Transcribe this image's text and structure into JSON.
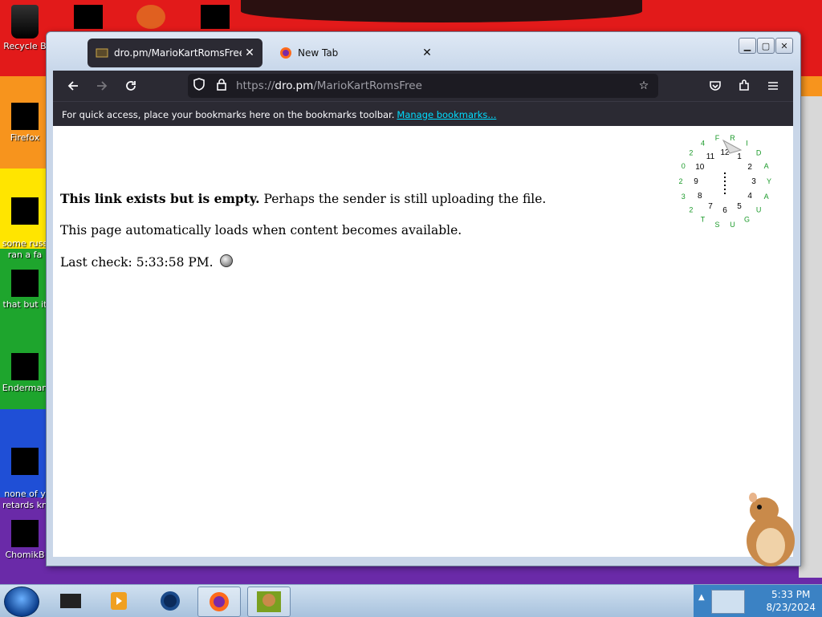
{
  "desktop": {
    "icons": [
      {
        "label": "Recycle Bin",
        "display": "Recycle B"
      },
      {
        "label": "Firefox",
        "display": "Firefox"
      },
      {
        "label": "some russ ran a fa",
        "display": "some russ\nran a fa"
      },
      {
        "label": "that but it",
        "display": "that but it"
      },
      {
        "label": "Enderman",
        "display": "Enderman"
      },
      {
        "label": "none of y retards kn",
        "display": "none of y\nretards kn"
      },
      {
        "label": "ChomikB",
        "display": "ChomikB"
      }
    ]
  },
  "browser": {
    "tabs": [
      {
        "title": "dro.pm/MarioKartRomsFree",
        "active": true
      },
      {
        "title": "New Tab",
        "active": false
      }
    ],
    "url": {
      "host": "dro.pm",
      "prefix": "https://",
      "path": "/MarioKartRomsFree"
    },
    "bookmarks_bar": {
      "text": "For quick access, place your bookmarks here on the bookmarks toolbar.",
      "link": "Manage bookmarks..."
    }
  },
  "page": {
    "line1_bold": "This link exists but is empty.",
    "line1_rest": " Perhaps the sender is still uploading the file.",
    "line2": "This page automatically loads when content becomes available.",
    "line3_prefix": "Last check: ",
    "line3_time": "5:33:58 PM."
  },
  "clock_widget": {
    "numbers": [
      "12",
      "1",
      "2",
      "3",
      "4",
      "5",
      "6",
      "7",
      "8",
      "9",
      "10",
      "11"
    ],
    "date_text": "FRIDAY AUGUST 23 2024"
  },
  "taskbar": {
    "time": "5:33 PM",
    "date": "8/23/2024"
  },
  "colors": {
    "browser_dark": "#2b2a33",
    "link": "#00ddff",
    "taskbar": "#cfe0f0"
  }
}
